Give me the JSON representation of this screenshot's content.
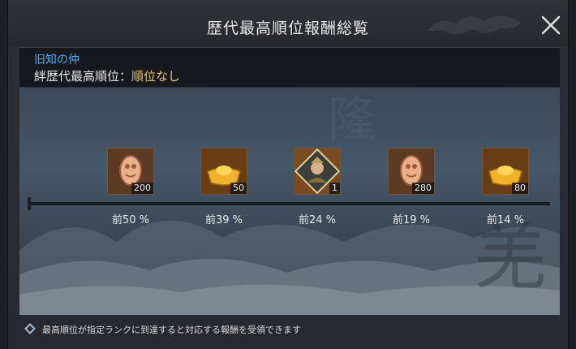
{
  "dialog": {
    "title": "歴代最高順位報酬総覧",
    "close_icon": "close-icon"
  },
  "guild": {
    "name": "旧知の仲",
    "rank_label": "絆歴代最高順位：",
    "rank_value": "順位なし"
  },
  "rewards": [
    {
      "icon": "jade-token-icon",
      "count": "200",
      "threshold": "前50 %"
    },
    {
      "icon": "gold-ingot-icon",
      "count": "50",
      "threshold": "前39 %"
    },
    {
      "icon": "general-portrait-icon",
      "count": "1",
      "threshold": "前24 %"
    },
    {
      "icon": "jade-token-icon",
      "count": "280",
      "threshold": "前19 %"
    },
    {
      "icon": "gold-ingot-icon",
      "count": "80",
      "threshold": "前14 %"
    }
  ],
  "footer": {
    "hint": "最高順位が指定ランクに到達すると対応する報酬を受領できます"
  }
}
